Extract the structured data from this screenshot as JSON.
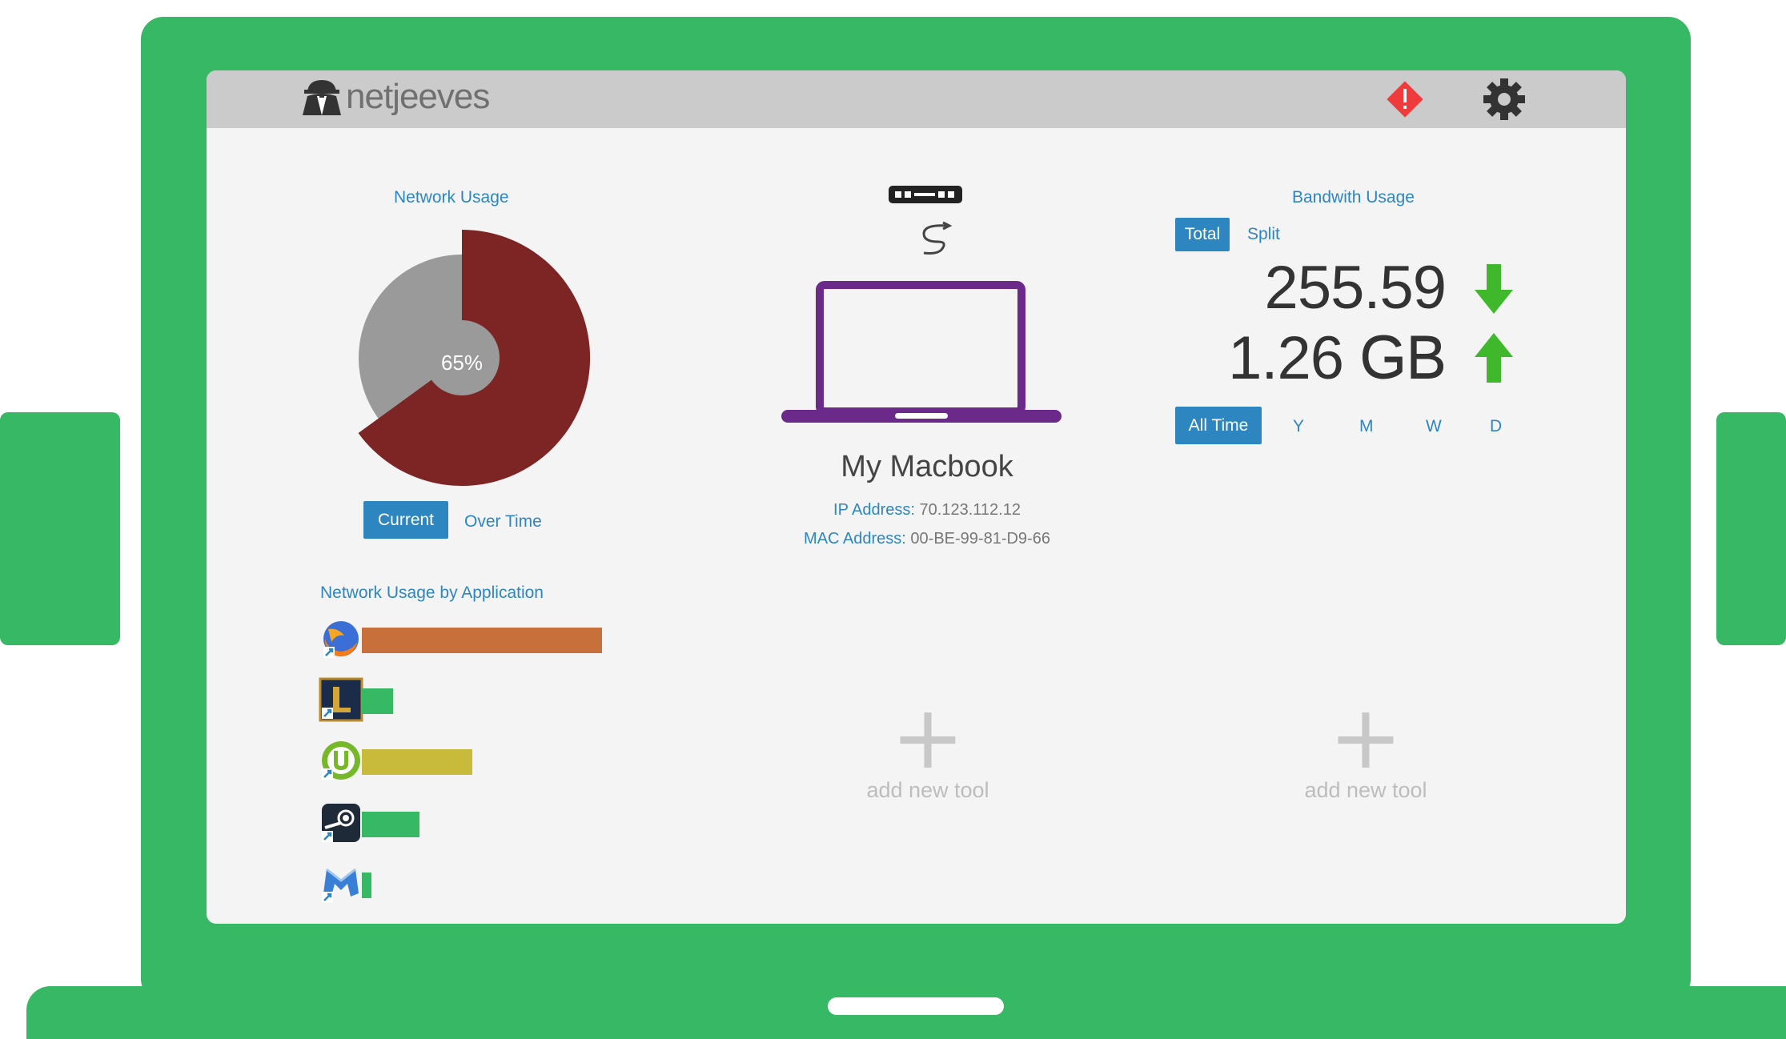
{
  "app": {
    "brand": "netjeeves"
  },
  "header": {
    "alert_icon": "alert-diamond-icon",
    "settings_icon": "gear-icon"
  },
  "network_usage": {
    "title": "Network Usage",
    "percent": 65,
    "percent_label": "65%",
    "tabs": {
      "current": "Current",
      "over_time": "Over Time"
    },
    "colors": {
      "used": "#7d2424",
      "remaining": "#9a9a9a"
    }
  },
  "apps_usage": {
    "title": "Network Usage by Application",
    "items": [
      {
        "icon": "firefox-icon",
        "value": 1.0,
        "color": "#c8703c"
      },
      {
        "icon": "league-of-legends-icon",
        "value": 0.13,
        "color": "#36b864"
      },
      {
        "icon": "utorrent-icon",
        "value": 0.46,
        "color": "#c8bb3c"
      },
      {
        "icon": "steam-icon",
        "value": 0.24,
        "color": "#36b864"
      },
      {
        "icon": "malwarebytes-icon",
        "value": 0.04,
        "color": "#36b864"
      }
    ]
  },
  "device": {
    "name": "My Macbook",
    "ip_label": "IP Address:",
    "ip": "70.123.112.12",
    "mac_label": "MAC Address:",
    "mac": "00-BE-99-81-D9-66",
    "icon": "laptop-icon",
    "router_icon": "router-icon",
    "cable_icon": "cable-icon",
    "accent": "#6b2a8a"
  },
  "bandwidth": {
    "title": "Bandwith Usage",
    "tabs": {
      "total": "Total",
      "split": "Split"
    },
    "download": "255.59 GB",
    "upload": "1.26 GB",
    "ranges": [
      "All Time",
      "Y",
      "M",
      "W",
      "D"
    ],
    "arrow_color": "#3fb82c"
  },
  "tools": {
    "add_label": "add new tool",
    "plus": "+"
  }
}
